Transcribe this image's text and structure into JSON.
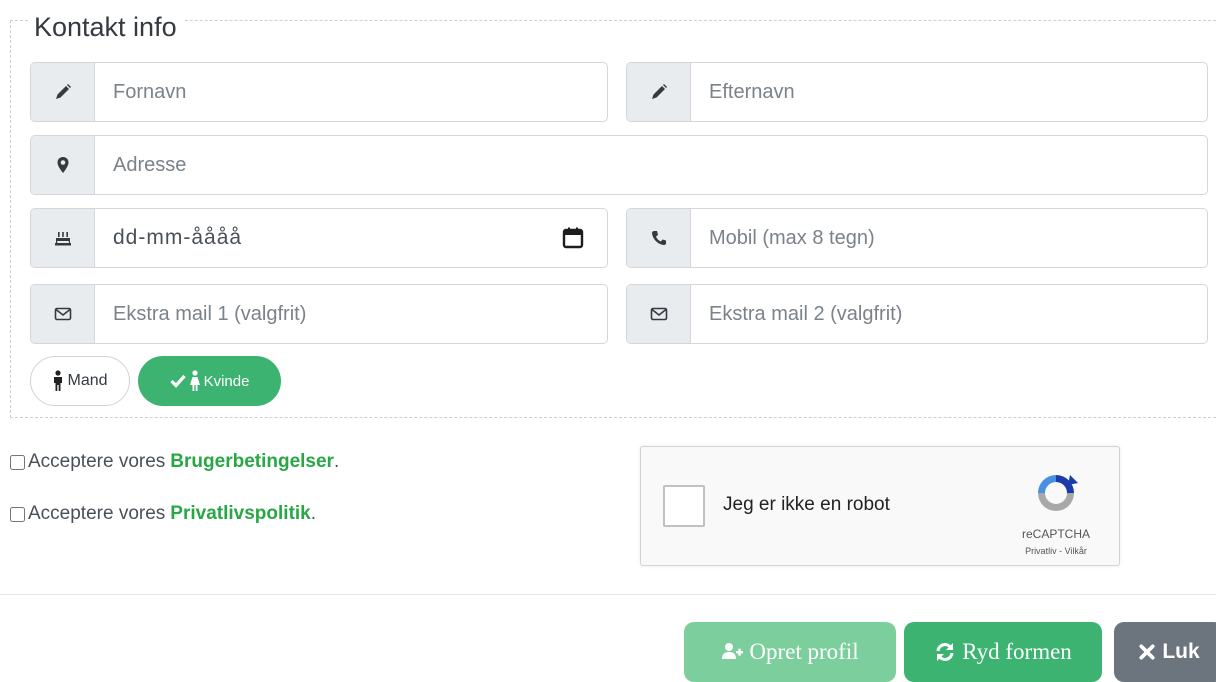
{
  "fieldset": {
    "legend": "Kontakt info"
  },
  "fields": {
    "firstname": {
      "placeholder": "Fornavn"
    },
    "lastname": {
      "placeholder": "Efternavn"
    },
    "address": {
      "placeholder": "Adresse"
    },
    "birthdate": {
      "value": "dd-mm-åååå"
    },
    "mobile": {
      "placeholder": "Mobil (max 8 tegn)"
    },
    "email1": {
      "placeholder": "Ekstra mail 1 (valgfrit)"
    },
    "email2": {
      "placeholder": "Ekstra mail 2 (valgfrit)"
    }
  },
  "gender": {
    "male": "Mand",
    "female": "Kvinde",
    "selected": "female"
  },
  "terms": {
    "prefix": "Acceptere vores",
    "user_terms": "Brugerbetingelser",
    "privacy": "Privatlivspolitik",
    "suffix": "."
  },
  "captcha": {
    "label": "Jeg er ikke en robot",
    "brand": "reCAPTCHA",
    "links": "Privatliv - Vilkår"
  },
  "buttons": {
    "create": "Opret profil",
    "reset": "Ryd formen",
    "close": "Luk"
  },
  "colors": {
    "accent": "#3cb371",
    "accent_light": "#7ccf9c",
    "secondary": "#6c757d",
    "link": "#28a745"
  }
}
